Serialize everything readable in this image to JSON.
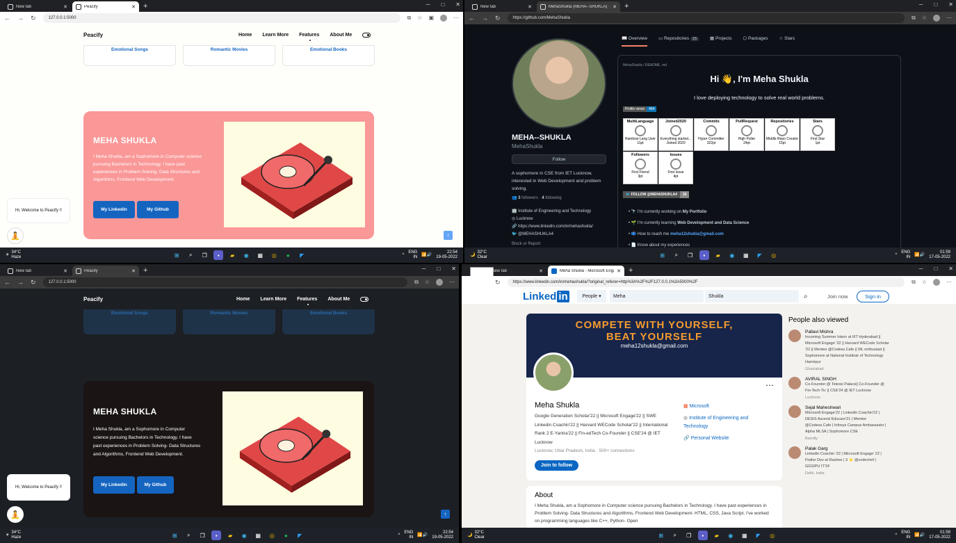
{
  "q1": {
    "tabs": [
      "New tab",
      "Peacify"
    ],
    "url": "127.0.0.1:5000",
    "site": {
      "brand": "Peacify",
      "links": [
        "Home",
        "Learn More",
        "Features",
        "About Me"
      ],
      "cards": [
        "Emotional Songs",
        "Romantic Movies",
        "Emotional Books"
      ],
      "name": "MEHA SHUKLA",
      "bio": "I Meha Shukla, am a Sophomore in Computer science pursuing Bachelors in Technology. I have past experiences in Problem Solving- Data Structures and Algorithms, Frontend Web Development.",
      "btn1": "My Linkedin",
      "btn2": "My Github",
      "chat": "Hi, Welcome to Peacify !!",
      "hero_color": "#fa9797",
      "bg": "#fefefa"
    },
    "taskbar": {
      "temp": "34°C",
      "weather": "Haze",
      "lang1": "ENG",
      "lang2": "IN",
      "time": "22:54",
      "date": "19-05-2022"
    }
  },
  "q2": {
    "tabs": [
      "New tab",
      "MehaShukla (MEHA--SHUKLA) · Gi..."
    ],
    "url": "https://github.com/MehaShukla",
    "tabs_gh": [
      "Overview",
      "Repositories",
      "Projects",
      "Packages",
      "Stars"
    ],
    "repo_count": "15",
    "fullname": "MEHA--SHUKLA",
    "login": "MehaShukla",
    "follow": "Follow",
    "bio": "A sophomore in CSE from IET Lucknow, interested in Web Development and problem solving.",
    "followers": "3",
    "followers_label": "followers",
    "following": "4",
    "following_label": "following",
    "org": "Institute of Engineering and Technology",
    "loc": "Lucknow",
    "site": "https://www.linkedin.com/in/mehashukla/",
    "twitter": "@MEHASHUKLA4",
    "block": "Block or Report",
    "readme_path": "MehaShukla / README .md",
    "greeting": "Hi 👋, I'm Meha Shukla",
    "tagline": "I love deploying technology to solve real world problems.",
    "views_label": "Profile views",
    "views": "464",
    "trophies": [
      {
        "t": "MultiLanguage",
        "s": "Rainbow Lang User",
        "v": "11pt"
      },
      {
        "t": "Joined2020",
        "s": "Everything started...",
        "v": "Joined 2020"
      },
      {
        "t": "Commits",
        "s": "Hyper Committer",
        "v": "322pt"
      },
      {
        "t": "PullRequest",
        "s": "High Puller",
        "v": "24pt"
      },
      {
        "t": "Repositories",
        "s": "Middle Repo Creator",
        "v": "15pt"
      },
      {
        "t": "Stars",
        "s": "First Star",
        "v": "1pt"
      },
      {
        "t": "Followers",
        "s": "First Friend",
        "v": "3pt"
      },
      {
        "t": "Issues",
        "s": "First Issue",
        "v": "4pt"
      }
    ],
    "tw_follow": "FOLLOW @MEHASHUKLA4",
    "tw_count": "16",
    "bullets": [
      "I'm currently working on ",
      "I'm currently learning ",
      "How to reach me ",
      "Know about my experiences"
    ],
    "bold": [
      "My Portfolio",
      "Web Development and Data Science",
      "meha12shukla@gmail.com"
    ],
    "taskbar": {
      "temp": "32°C",
      "weather": "Clear",
      "lang1": "ENG",
      "lang2": "IN",
      "time": "01:59",
      "date": "17-05-2022"
    }
  },
  "q3": {
    "tabs": [
      "New tab",
      "Peacify"
    ],
    "url": "127.0.0.1:5000",
    "hero_color": "#1a1414",
    "bg": "#1c1f24",
    "taskbar": {
      "temp": "34°C",
      "weather": "Haze",
      "lang1": "ENG",
      "lang2": "IN",
      "time": "22:54",
      "date": "19-05-2022"
    }
  },
  "q4": {
    "tabs": [
      "New tab",
      "Meha Shukla - Microsoft Engage'..."
    ],
    "url": "https://www.linkedin.com/in/mehashukla/?original_referer=http%3A%2F%2F127.0.0.1%3A5000%2F",
    "logo": "Linked",
    "logo2": "in",
    "dropdown": "People",
    "search1": "Meha",
    "search2": "Shukla",
    "join": "Join now",
    "signin": "Sign in",
    "banner1": "COMPETE WITH YOURSELF,",
    "banner2": "BEAT YOURSELF",
    "banner_email": "meha12shukla@gmail.com",
    "name": "Meha Shukla",
    "headline": "Google Generation Scholar'22 || Microsoft Engage'22 || SWE Linkedin Coachin'22 || Harvard WECode Scholar'22 || International Rank 2 E-Yantra'22 || Fin-edTech Co-Founder || CSE'24 @ IET Lucknow",
    "location": "Lucknow, Uttar Pradesh, India",
    "connections": "500+ connections",
    "cta": "Join to follow",
    "c1": "Microsoft",
    "c2": "Institute of Engineering and Technology",
    "c3": "Personal Website",
    "about_h": "About",
    "about": "I Meha Shukla, am a Sophomore in Computer science pursuing Bachelors in Technology. I have past experiences in Problem Solving- Data Structures and Algorithms, Frontend Web Development- HTML, CSS, Java Script. I've worked on programming languages like C++, Python- Open",
    "pav": "People also viewed",
    "people": [
      {
        "n": "Pallavi Mishra",
        "h": "Incoming Summer Intern at IIIT Hyderabad || Microsoft Engage '22 || Harvard WECode Scholar '22 || Mentee @Codess.Cafe || ML enthusiast || Sophomore at National Institute of Technology Hamirpur",
        "l": "Ghaziabad"
      },
      {
        "n": "AVIRAL SINGH",
        "h": "Co-Founder @ Telesis Palace|| Co-Founder @ Fin-Tech-Tic || CSE'24 @ IET Lucknow",
        "l": "Lucknow"
      },
      {
        "n": "Sejal Maheshwari",
        "h": "Microsoft Engage'22 | LinkedIn Coachin'22 | DESIS Ascend Educare'21 | Mentee @Codess.Cafe | Infosys Campus Ambassador | Alpha MLSA | Sophomore CSE",
        "l": "Bareilly"
      },
      {
        "n": "Palak Garg",
        "h": "Linkedin Coachin '22 | Microsoft Engage' 22 | Flutter Dev at Rashee | 3 ⭐ @codechef | GGSIPU IT'24",
        "l": "Delhi, India"
      }
    ],
    "taskbar": {
      "temp": "32°C",
      "weather": "Clear",
      "lang1": "ENG",
      "lang2": "IN",
      "time": "01:59",
      "date": "17-05-2022"
    }
  }
}
